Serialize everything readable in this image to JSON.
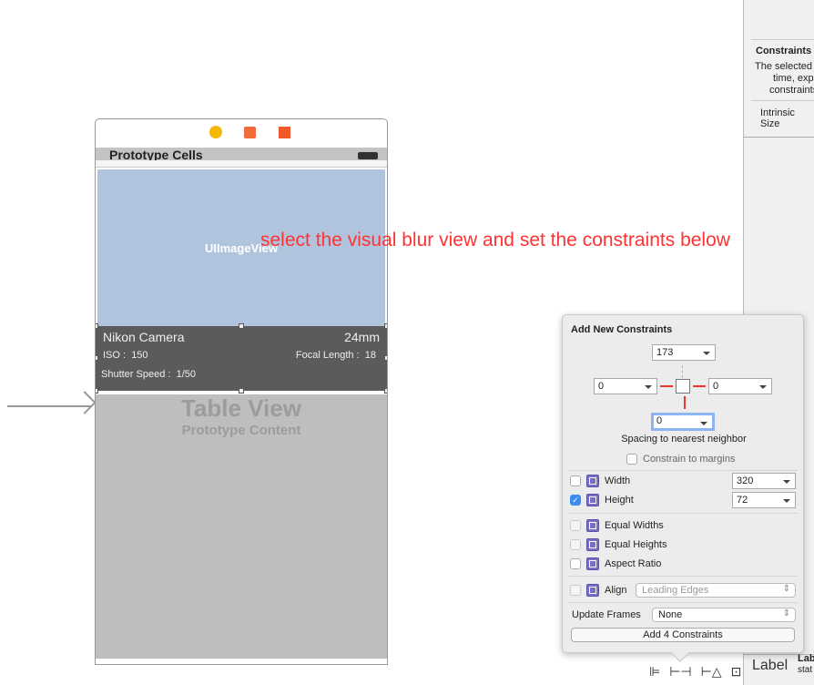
{
  "inspector": {
    "constraints_title": "Constraints",
    "constraints_desc": [
      "The selected",
      "time, exp",
      "constraints"
    ],
    "intrinsic_size": "Intrinsic Size"
  },
  "scene": {
    "nav_title": "Prototype Cells",
    "image_view_label": "UIImageView",
    "cell": {
      "title": "Nikon Camera",
      "focal_value": "24mm",
      "iso_label": "ISO :",
      "iso_value": "150",
      "focal_label": "Focal Length :",
      "focal_length_value": "18",
      "shutter_label": "Shutter Speed :",
      "shutter_value": "1/50"
    },
    "table_view_label": "Table View",
    "prototype_content_label": "Prototype Content"
  },
  "annotation": {
    "text": "select the visual blur view and set the constraints below",
    "color": "#ff3333"
  },
  "popover": {
    "title": "Add New Constraints",
    "top": "173",
    "left": "0",
    "right": "0",
    "bottom": "0",
    "spacing_label": "Spacing to nearest neighbor",
    "constrain_margins": {
      "label": "Constrain to margins",
      "checked": false
    },
    "width": {
      "label": "Width",
      "checked": false,
      "value": "320"
    },
    "height": {
      "label": "Height",
      "checked": true,
      "value": "72"
    },
    "equal_widths": "Equal Widths",
    "equal_heights": "Equal Heights",
    "aspect_ratio": "Aspect Ratio",
    "align": {
      "label": "Align",
      "value": "Leading Edges"
    },
    "update_frames": {
      "label": "Update Frames",
      "value": "None"
    },
    "add_button": "Add 4 Constraints"
  },
  "library": {
    "label": "Label",
    "title": "Lab",
    "desc": "stat"
  },
  "accent": "#3b8ef0"
}
